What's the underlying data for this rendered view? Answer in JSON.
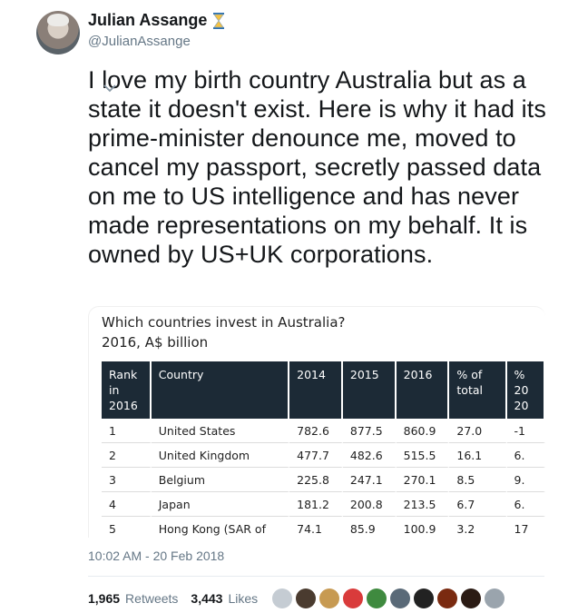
{
  "author": {
    "display_name": "Julian Assange",
    "handle": "@JulianAssange",
    "badge_icon": "hourglass-icon"
  },
  "tweet": {
    "text": "I love my birth country Australia but as a state it doesn't exist. Here is why it had its prime-minister denounce me, moved to cancel my passport, secretly passed data on me to US intelligence and has never made representations on my behalf. It is owned by US+UK corporations."
  },
  "media": {
    "title": "Which countries invest in Australia?",
    "subtitle": "2016, A$ billion",
    "headers": [
      "Rank in 2016",
      "Country",
      "2014",
      "2015",
      "2016",
      "% of total",
      "% 20 20"
    ],
    "rows": [
      [
        "1",
        "United States",
        "782.6",
        "877.5",
        "860.9",
        "27.0",
        "-1"
      ],
      [
        "2",
        "United Kingdom",
        "477.7",
        "482.6",
        "515.5",
        "16.1",
        "6."
      ],
      [
        "3",
        "Belgium",
        "225.8",
        "247.1",
        "270.1",
        "8.5",
        "9."
      ],
      [
        "4",
        "Japan",
        "181.2",
        "200.8",
        "213.5",
        "6.7",
        "6."
      ],
      [
        "5",
        "Hong Kong (SAR of",
        "74.1",
        "85.9",
        "100.9",
        "3.2",
        "17"
      ]
    ]
  },
  "meta": {
    "timestamp": "10:02 AM - 20 Feb 2018"
  },
  "stats": {
    "retweets_count": "1,965",
    "retweets_label": "Retweets",
    "likes_count": "3,443",
    "likes_label": "Likes"
  },
  "likers": [
    {
      "name": "default-avatar",
      "color": "#c5ccd3"
    },
    {
      "name": "liker-avatar",
      "color": "#4a3b2f"
    },
    {
      "name": "liker-avatar",
      "color": "#c79a52"
    },
    {
      "name": "liker-avatar",
      "color": "#d93b3b"
    },
    {
      "name": "liker-avatar",
      "color": "#3f8a3f"
    },
    {
      "name": "liker-avatar",
      "color": "#5a6a78"
    },
    {
      "name": "liker-avatar",
      "color": "#222222"
    },
    {
      "name": "liker-avatar",
      "color": "#7a2a10"
    },
    {
      "name": "liker-avatar",
      "color": "#2b1b14"
    },
    {
      "name": "liker-avatar",
      "color": "#9aa4ad"
    }
  ]
}
